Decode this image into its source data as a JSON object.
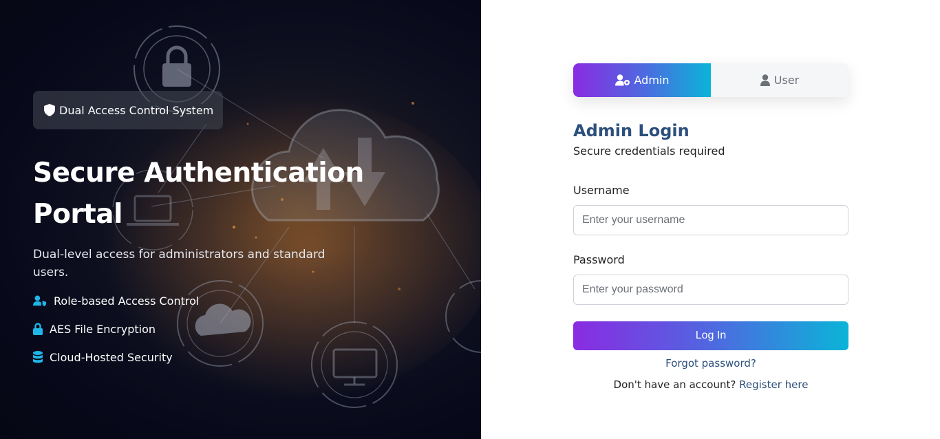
{
  "hero": {
    "badge_label": "Dual Access Control System",
    "title": "Secure Authentication Portal",
    "subtitle": "Dual-level access for administrators and standard users.",
    "features": [
      {
        "label": "Role-based Access Control",
        "icon": "user-shield-icon"
      },
      {
        "label": "AES File Encryption",
        "icon": "lock-icon"
      },
      {
        "label": "Cloud-Hosted Security",
        "icon": "database-icon"
      }
    ]
  },
  "login": {
    "tabs": [
      {
        "label": "Admin",
        "icon": "user-gear-icon",
        "active": true
      },
      {
        "label": "User",
        "icon": "user-icon",
        "active": false
      }
    ],
    "title": "Admin Login",
    "subtitle": "Secure credentials required",
    "username_label": "Username",
    "username_placeholder": "Enter your username",
    "username_value": "",
    "password_label": "Password",
    "password_placeholder": "Enter your password",
    "password_value": "",
    "submit_label": "Log In",
    "forgot_label": "Forgot password?",
    "register_prompt": "Don't have an account?",
    "register_label": "Register here"
  },
  "colors": {
    "accent_start": "#8a2be2",
    "accent_end": "#0bb4d8",
    "heading": "#2c4f7c",
    "feature_icon": "#1fb6e8"
  }
}
